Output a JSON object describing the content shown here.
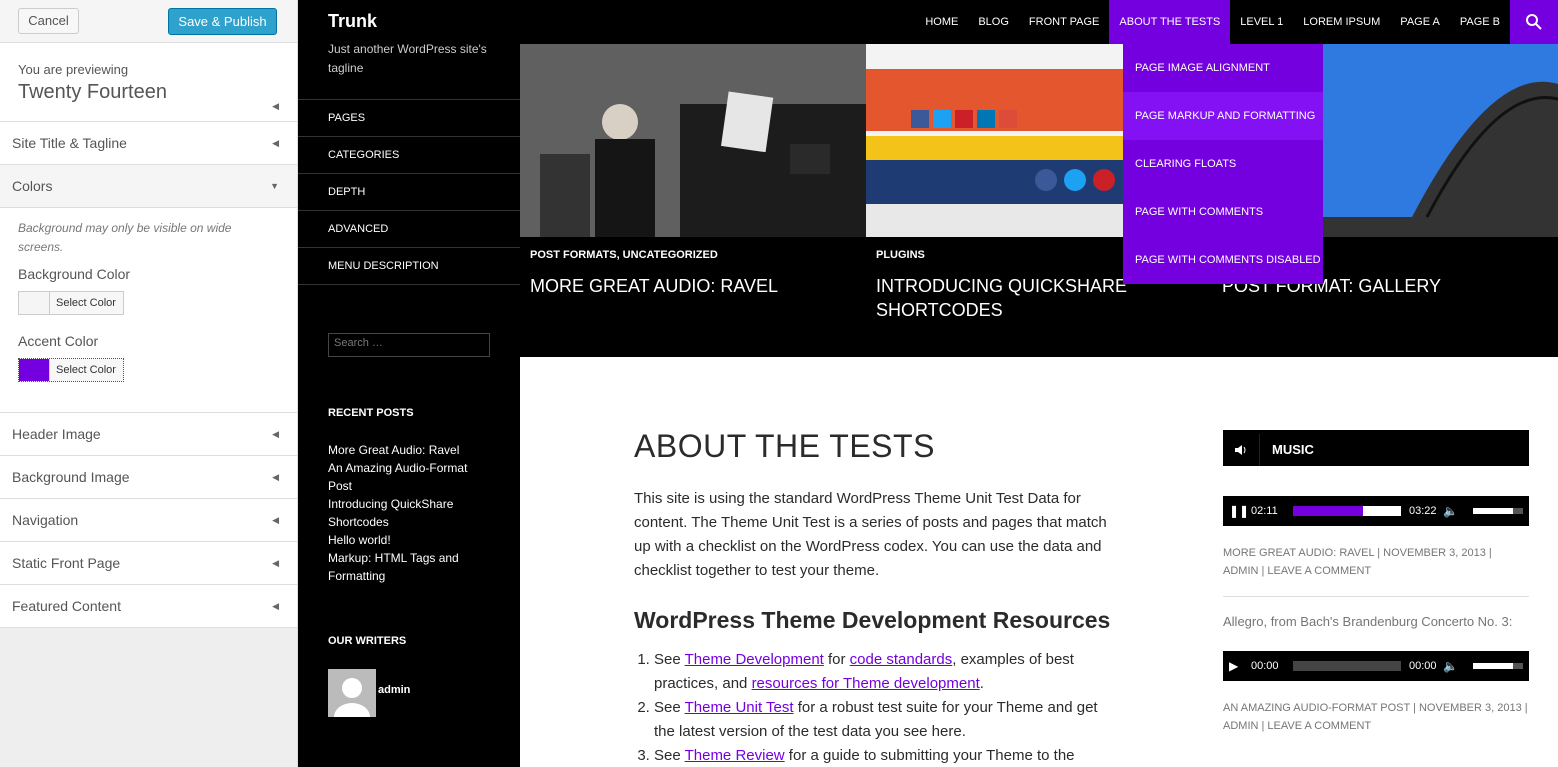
{
  "customizer": {
    "cancel_label": "Cancel",
    "publish_label": "Save & Publish",
    "previewing_label": "You are previewing",
    "theme_name": "Twenty Fourteen",
    "sections": {
      "site_title": "Site Title & Tagline",
      "colors": "Colors",
      "header_image": "Header Image",
      "background_image": "Background Image",
      "navigation": "Navigation",
      "static_front_page": "Static Front Page",
      "featured_content": "Featured Content"
    },
    "colors": {
      "description": "Background may only be visible on wide screens.",
      "background_label": "Background Color",
      "background_value": "#f5f5f5",
      "accent_label": "Accent Color",
      "accent_value": "#7400e0",
      "select_label": "Select Color"
    }
  },
  "site": {
    "title": "Trunk",
    "tagline": "Just another WordPress site's tagline",
    "nav": [
      "HOME",
      "BLOG",
      "FRONT PAGE",
      "ABOUT THE TESTS",
      "LEVEL 1",
      "LOREM IPSUM",
      "PAGE A",
      "PAGE B"
    ],
    "dropdown": [
      "PAGE IMAGE ALIGNMENT",
      "PAGE MARKUP AND FORMATTING",
      "CLEARING FLOATS",
      "PAGE WITH COMMENTS",
      "PAGE WITH COMMENTS DISABLED"
    ],
    "secondary_menu": [
      "PAGES",
      "CATEGORIES",
      "DEPTH",
      "ADVANCED",
      "MENU DESCRIPTION"
    ],
    "search_placeholder": "Search …",
    "recent_posts_title": "RECENT POSTS",
    "recent_posts": [
      "More Great Audio: Ravel",
      "An Amazing Audio-Format Post",
      "Introducing QuickShare Shortcodes",
      "Hello world!",
      "Markup: HTML Tags and Formatting"
    ],
    "writers_title": "OUR WRITERS",
    "writer_name": "admin",
    "featured": [
      {
        "category": "POST FORMATS, UNCATEGORIZED",
        "title": "MORE GREAT AUDIO: RAVEL"
      },
      {
        "category": "PLUGINS",
        "title": "INTRODUCING QUICKSHARE SHORTCODES"
      },
      {
        "category": "",
        "title": "POST FORMAT: GALLERY"
      }
    ],
    "page": {
      "title": "ABOUT THE TESTS",
      "intro": "This site is using the standard WordPress Theme Unit Test Data for content. The Theme Unit Test is a series of posts and pages that match up with a checklist on the WordPress codex. You can use the data and checklist together to test your theme.",
      "resources_title": "WordPress Theme Development Resources",
      "item1": {
        "see": "See ",
        "link1": "Theme Development",
        "for": " for ",
        "link2": "code standards",
        "rest": ", examples of best practices, and ",
        "link3": "resources for Theme development",
        "end": "."
      },
      "item2": {
        "see": "See ",
        "link1": "Theme Unit Test",
        "rest": " for a robust test suite for your Theme and get the latest version of the test data you see here."
      },
      "item3": {
        "see": "See ",
        "link1": "Theme Review",
        "rest": " for a guide to submitting your Theme to the"
      }
    },
    "music": {
      "title": "MUSIC",
      "player1": {
        "current": "02:11",
        "duration": "03:22",
        "progress": 0.65
      },
      "meta1": "MORE GREAT AUDIO: RAVEL | NOVEMBER 3, 2013 | ADMIN | LEAVE A COMMENT",
      "caption2": "Allegro, from Bach's Brandenburg Concerto No. 3:",
      "player2": {
        "current": "00:00",
        "duration": "00:00",
        "progress": 0
      },
      "meta2": "AN AMAZING AUDIO-FORMAT POST | NOVEMBER 3, 2013 | ADMIN | LEAVE A COMMENT"
    }
  }
}
